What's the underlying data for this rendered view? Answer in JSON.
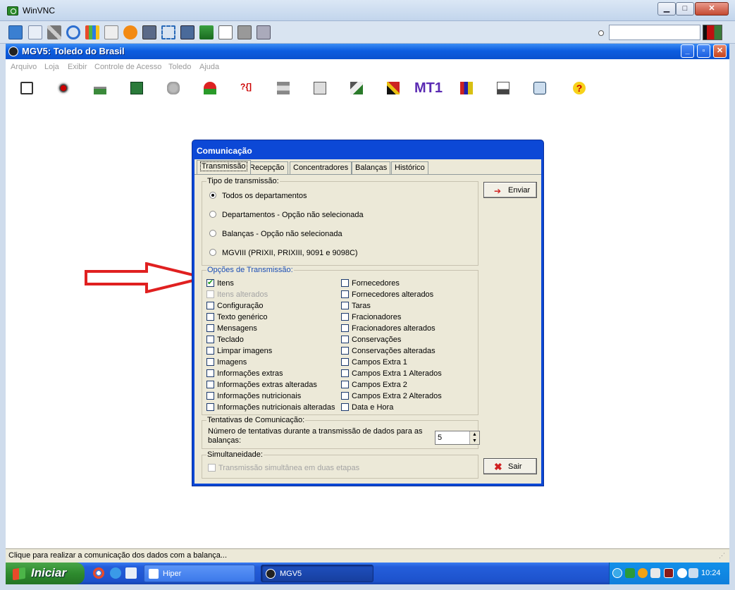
{
  "vnc": {
    "title": "WinVNC",
    "min": "▁",
    "max": "□",
    "close": "✕"
  },
  "mgv": {
    "title": "MGV5: Toledo do Brasil",
    "min": "_",
    "max": "▫",
    "close": "✕",
    "menu": [
      "Arquivo",
      "Loja",
      "Exibir",
      "Controle de Acesso",
      "Toledo",
      "Ajuda"
    ],
    "toolbar_text_label": "MT1",
    "help_glyph": "?",
    "func_glyph": "?{]"
  },
  "dialog": {
    "title": "Comunicação",
    "tabs": [
      "Transmissão",
      "Recepção",
      "Concentradores",
      "Balanças",
      "Histórico"
    ],
    "active_tab": "Transmissão",
    "tipo": {
      "legend": "Tipo de transmissão:",
      "options": [
        {
          "label": "Todos os departamentos",
          "selected": true
        },
        {
          "label": "Departamentos - Opção não selecionada",
          "selected": false
        },
        {
          "label": "Balanças - Opção não selecionada",
          "selected": false
        },
        {
          "label": "MGVIII (PRIXII, PRIXIII, 9091 e 9098C)",
          "selected": false
        }
      ]
    },
    "opcoes": {
      "legend": "Opções de Transmissão:",
      "left": [
        {
          "label": "Itens",
          "checked": true,
          "disabled": false
        },
        {
          "label": "Itens alterados",
          "checked": false,
          "disabled": true
        },
        {
          "label": "Configuração",
          "checked": false,
          "disabled": false
        },
        {
          "label": "Texto genérico",
          "checked": false,
          "disabled": false
        },
        {
          "label": "Mensagens",
          "checked": false,
          "disabled": false
        },
        {
          "label": "Teclado",
          "checked": false,
          "disabled": false
        },
        {
          "label": "Limpar imagens",
          "checked": false,
          "disabled": false
        },
        {
          "label": "Imagens",
          "checked": false,
          "disabled": false
        },
        {
          "label": "Informações extras",
          "checked": false,
          "disabled": false
        },
        {
          "label": "Informações extras alteradas",
          "checked": false,
          "disabled": false
        },
        {
          "label": "Informações nutricionais",
          "checked": false,
          "disabled": false
        },
        {
          "label": "Informações nutricionais alteradas",
          "checked": false,
          "disabled": false
        }
      ],
      "right": [
        {
          "label": "Fornecedores",
          "checked": false
        },
        {
          "label": "Fornecedores alterados",
          "checked": false
        },
        {
          "label": "Taras",
          "checked": false
        },
        {
          "label": "Fracionadores",
          "checked": false
        },
        {
          "label": "Fracionadores alterados",
          "checked": false
        },
        {
          "label": "Conservações",
          "checked": false
        },
        {
          "label": "Conservações alteradas",
          "checked": false
        },
        {
          "label": "Campos Extra 1",
          "checked": false
        },
        {
          "label": "Campos Extra 1 Alterados",
          "checked": false
        },
        {
          "label": "Campos Extra 2",
          "checked": false
        },
        {
          "label": "Campos Extra 2 Alterados",
          "checked": false
        },
        {
          "label": "Data e Hora",
          "checked": false
        }
      ]
    },
    "tentativas": {
      "legend": "Tentativas de Comunicação:",
      "text": "Número de tentativas durante a transmissão de dados para as balanças:",
      "value": "5"
    },
    "simultaneidade": {
      "legend": "Simultaneidade:",
      "checkbox_label": "Transmissão simultânea em duas etapas"
    },
    "enviar_label": "Enviar",
    "sair_label": "Sair"
  },
  "status": {
    "text": "Clique para realizar a comunicação dos dados com a balança..."
  },
  "taskbar": {
    "start_label": "Iniciar",
    "tasks": [
      "Hiper",
      "MGV5"
    ],
    "clock": "10:24"
  },
  "colors": {
    "accent_blue": "#0c48d6",
    "arrow_red": "#e02020",
    "check_green": "#1a9a1a"
  }
}
